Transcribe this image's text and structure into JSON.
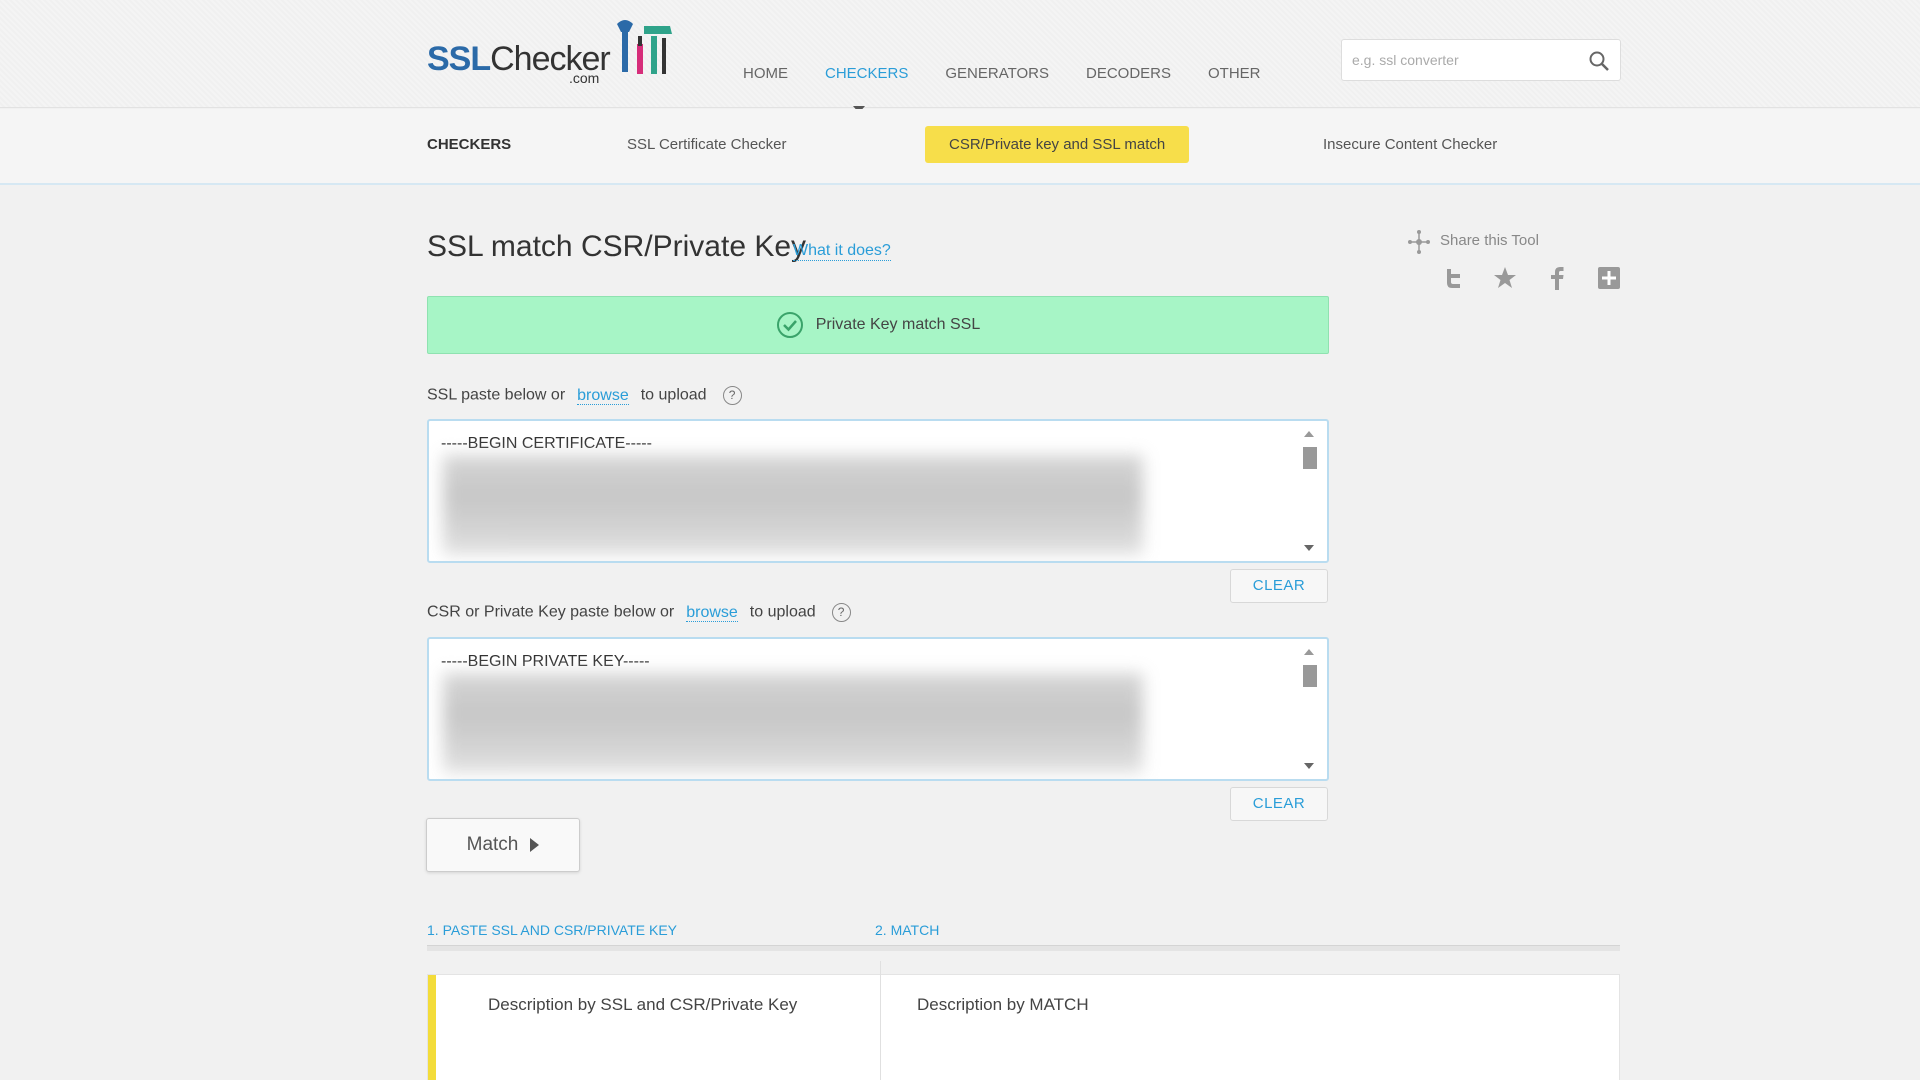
{
  "logo": {
    "ssl": "SSL",
    "checker": "Checker",
    "com": ".com"
  },
  "nav": {
    "items": [
      {
        "label": "HOME",
        "active": false
      },
      {
        "label": "CHECKERS",
        "active": true
      },
      {
        "label": "GENERATORS",
        "active": false
      },
      {
        "label": "DECODERS",
        "active": false
      },
      {
        "label": "OTHER",
        "active": false
      }
    ]
  },
  "search": {
    "placeholder": "e.g. ssl converter",
    "icon": "search-icon"
  },
  "subnav": {
    "title": "CHECKERS",
    "links": [
      {
        "label": "SSL Certificate Checker",
        "active": false
      },
      {
        "label": "CSR/Private key and SSL match",
        "active": true
      },
      {
        "label": "Insecure Content Checker",
        "active": false
      }
    ]
  },
  "main": {
    "title": "SSL match CSR/Private Key",
    "what_link": "What it does?",
    "success_message": "Private Key match SSL",
    "ssl_field": {
      "label_before": "SSL paste below or",
      "browse": "browse",
      "label_after": "to upload",
      "help": "?",
      "first_line": "-----BEGIN CERTIFICATE-----",
      "clear": "CLEAR"
    },
    "key_field": {
      "label_before": "CSR or Private Key paste below or",
      "browse": "browse",
      "label_after": "to upload",
      "help": "?",
      "first_line": "-----BEGIN PRIVATE KEY-----",
      "clear": "CLEAR"
    },
    "match_button": "Match"
  },
  "steps": {
    "step1": "1. PASTE SSL AND CSR/PRIVATE KEY",
    "step2": "2. MATCH",
    "desc1": "Description by SSL and CSR/Private Key",
    "desc2": "Description by MATCH"
  },
  "share": {
    "label": "Share this Tool",
    "icons": [
      "twitter-icon",
      "star-icon",
      "facebook-icon",
      "plus-icon"
    ]
  },
  "colors": {
    "accent": "#2a9dd8",
    "highlight": "#f7de4a",
    "success": "#a7f5c6"
  }
}
